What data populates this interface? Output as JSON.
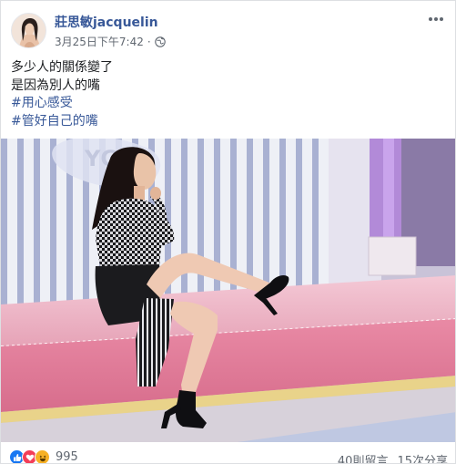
{
  "post": {
    "author": "莊思敏jacquelin",
    "timestamp": "3月25日下午7:42",
    "privacy_icon": "globe-icon",
    "more_icon": "ellipsis-icon"
  },
  "caption": {
    "line1": "多少人的關係變了",
    "line2": "是因為別人的嘴",
    "hashtag1": "#用心感受",
    "hashtag2": "#管好自己的嘴"
  },
  "photo": {
    "icon": "photo-woman-seated-on-pink-stage"
  },
  "footer": {
    "reaction_icons": [
      "like-icon",
      "love-icon",
      "haha-icon"
    ],
    "reaction_count": "995",
    "comments": "40則留言",
    "shares": "15次分享"
  },
  "colors": {
    "link": "#385898",
    "text": "#1c1e21",
    "meta": "#606770",
    "like_blue": "#1877f2",
    "love_red": "#f33e58",
    "haha_yellow": "#f7b125"
  }
}
